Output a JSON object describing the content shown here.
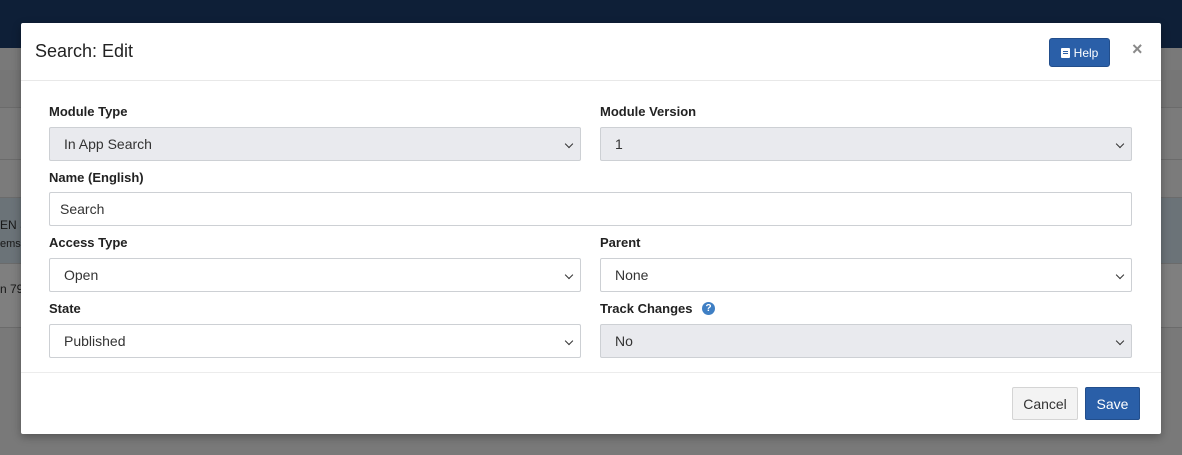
{
  "background": {
    "fragments": [
      "EN S",
      "ems",
      "n 79"
    ]
  },
  "modal": {
    "title": "Search: Edit",
    "help_label": "Help",
    "close_symbol": "×",
    "fields": {
      "module_type": {
        "label": "Module Type",
        "value": "In App Search"
      },
      "module_version": {
        "label": "Module Version",
        "value": "1"
      },
      "name": {
        "label": "Name (English)",
        "value": "Search"
      },
      "access_type": {
        "label": "Access Type",
        "value": "Open"
      },
      "parent": {
        "label": "Parent",
        "value": "None"
      },
      "state": {
        "label": "State",
        "value": "Published"
      },
      "track_changes": {
        "label": "Track Changes",
        "value": "No"
      }
    },
    "cancel_label": "Cancel",
    "save_label": "Save"
  },
  "colors": {
    "primary": "#2a5fa8",
    "topbar": "#1c3f6e",
    "disabled_field": "#e9eaee",
    "info_icon": "#3f7fc4"
  },
  "icons": [
    "book-icon",
    "close-icon",
    "chevron-down-icon",
    "question-icon"
  ]
}
